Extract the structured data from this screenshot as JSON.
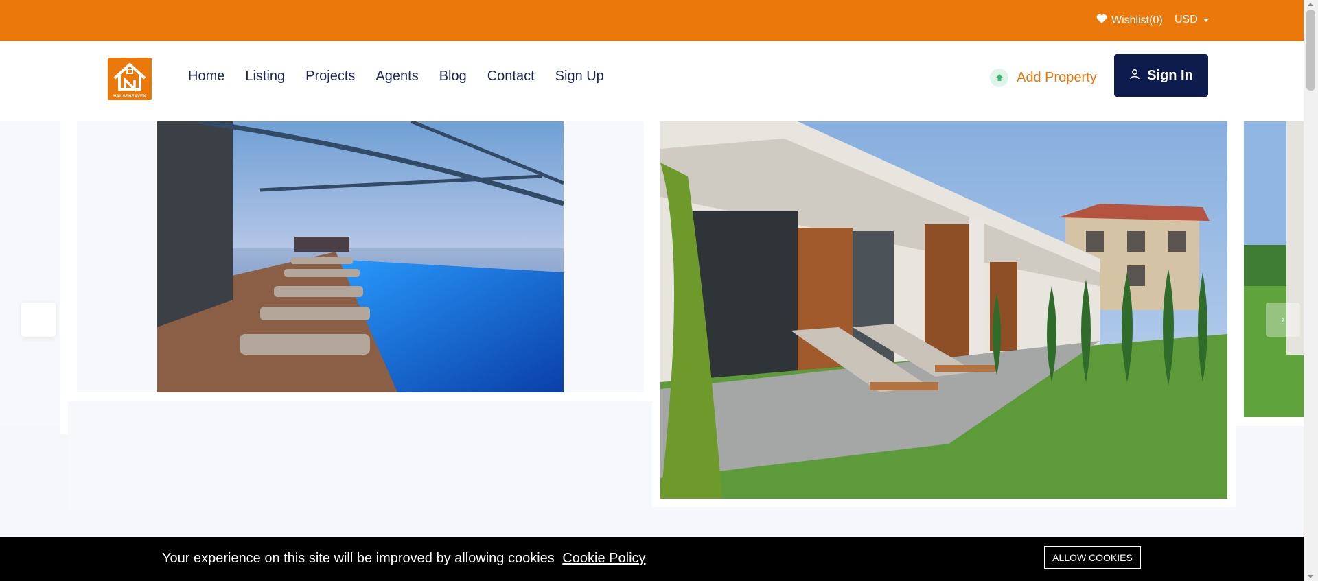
{
  "topbar": {
    "wishlist_label": "Wishlist(0)",
    "currency_label": "USD",
    "bg_color": "#ea780b"
  },
  "navbar": {
    "logo_text": "HAUSEHEAVEN",
    "links": [
      {
        "label": "Home"
      },
      {
        "label": "Listing"
      },
      {
        "label": "Projects"
      },
      {
        "label": "Agents"
      },
      {
        "label": "Blog"
      },
      {
        "label": "Contact"
      },
      {
        "label": "Sign Up"
      }
    ],
    "add_property_label": "Add Property",
    "sign_in_label": "Sign In"
  },
  "slider": {
    "slides": [
      {
        "image": "rooftop infinity pool with sun loungers at sunset"
      },
      {
        "image": "modern villa patio with loungers and garden"
      },
      {
        "image": "garden lawn (partially visible)"
      }
    ]
  },
  "cookie_banner": {
    "message": "Your experience on this site will be improved by allowing cookies",
    "policy_link": "Cookie Policy",
    "allow_button": "ALLOW COOKIES"
  },
  "colors": {
    "accent": "#ea780b",
    "navy": "#0e1b4d",
    "nav_text": "#1c2753"
  }
}
